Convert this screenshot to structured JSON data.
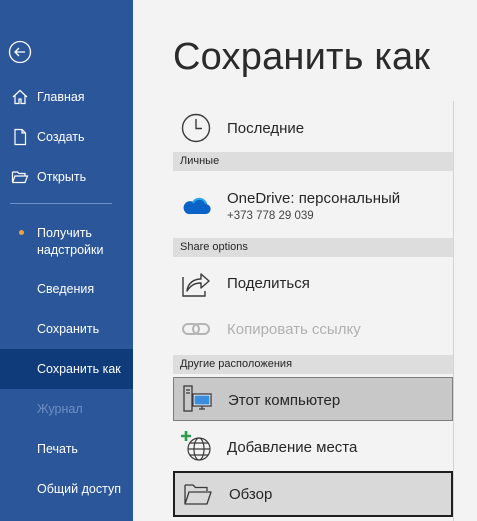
{
  "sidebar": {
    "back_label": "",
    "items": [
      {
        "label": "Главная",
        "icon": "home-icon"
      },
      {
        "label": "Создать",
        "icon": "new-document-icon"
      },
      {
        "label": "Открыть",
        "icon": "open-folder-icon"
      },
      {
        "label": "Получить надстройки",
        "icon": "dot-icon"
      },
      {
        "label": "Сведения"
      },
      {
        "label": "Сохранить"
      },
      {
        "label": "Сохранить как"
      },
      {
        "label": "Журнал"
      },
      {
        "label": "Печать"
      },
      {
        "label": "Общий доступ"
      }
    ]
  },
  "page": {
    "title": "Сохранить как"
  },
  "locations": {
    "recent": {
      "label": "Последние",
      "icon": "clock-icon"
    },
    "personal_header": "Личные",
    "onedrive": {
      "label": "OneDrive: персональный",
      "sub": "+373 778 29 039",
      "icon": "onedrive-cloud-icon"
    },
    "share_header": "Share options",
    "share": {
      "label": "Поделиться",
      "icon": "share-icon"
    },
    "copy_link": {
      "label": "Копировать ссылку",
      "icon": "link-icon"
    },
    "other_header": "Другие расположения",
    "this_pc": {
      "label": "Этот компьютер",
      "icon": "computer-icon"
    },
    "add_place": {
      "label": "Добавление места",
      "icon": "add-place-globe-icon"
    },
    "browse": {
      "label": "Обзор",
      "icon": "browse-folder-icon"
    }
  },
  "colors": {
    "sidebar_bg": "#2b579a",
    "sidebar_active": "#0f3b7a",
    "accent_dot": "#f0a33c",
    "onedrive_blue": "#0a64c8"
  }
}
